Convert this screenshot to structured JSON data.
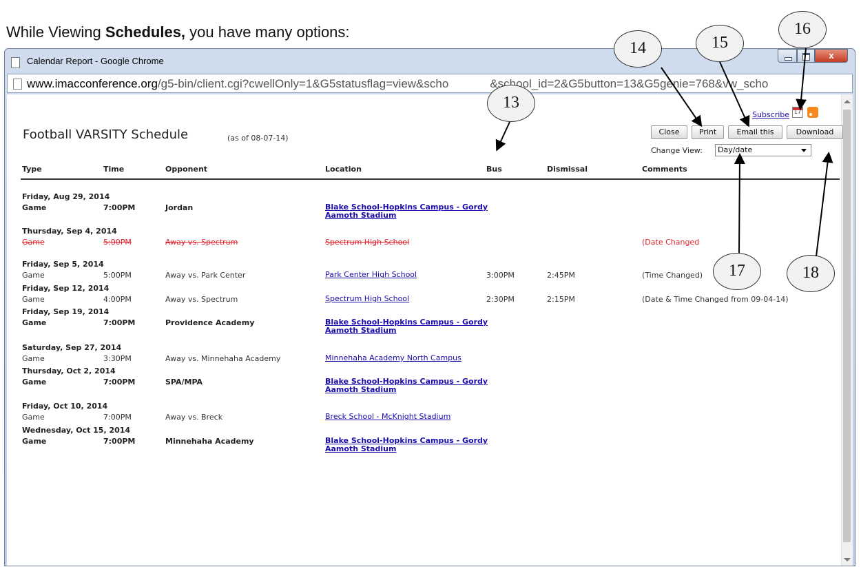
{
  "caption": {
    "prefix": "While Viewing ",
    "bold": "Schedules,",
    "suffix": " you have many options:"
  },
  "window": {
    "title": "Calendar Report - Google Chrome",
    "close_label": "x"
  },
  "address": {
    "domain": "www.imacconference.org",
    "path": "/g5-bin/client.cgi?cwellOnly=1&G5statusflag=view&scho",
    "path2": "&school_id=2&G5button=13&G5genie=768&vw_scho"
  },
  "header": {
    "title": "Football VARSITY Schedule",
    "as_of": "(as of 08-07-14)",
    "subscribe": "Subscribe",
    "buttons": {
      "close": "Close",
      "print": "Print",
      "email": "Email this",
      "download": "Download"
    },
    "change_view_label": "Change View:",
    "change_view_value": "Day/date"
  },
  "columns": [
    "Type",
    "Time",
    "Opponent",
    "Location",
    "Bus",
    "Dismissal",
    "Comments"
  ],
  "events": [
    {
      "date": "Friday, Aug 29, 2014",
      "type": "Game",
      "time": "7:00PM",
      "opponent": "Jordan",
      "location": "Blake School-Hopkins Campus - Gordy Aamoth Stadium",
      "bus": "",
      "dismissal": "",
      "comments": "",
      "home": true,
      "cancelled": false
    },
    {
      "date": "Thursday, Sep 4, 2014",
      "type": "Game",
      "time": "5:00PM",
      "opponent": "Away vs. Spectrum",
      "location": "Spectrum High School",
      "bus": "",
      "dismissal": "",
      "comments": "(Date Changed",
      "home": false,
      "cancelled": true
    },
    {
      "date": "Friday, Sep 5, 2014",
      "type": "Game",
      "time": "5:00PM",
      "opponent": "Away vs. Park Center",
      "location": "Park Center High School",
      "bus": "3:00PM",
      "dismissal": "2:45PM",
      "comments": "(Time Changed)",
      "home": false,
      "cancelled": false
    },
    {
      "date": "Friday, Sep 12, 2014",
      "type": "Game",
      "time": "4:00PM",
      "opponent": "Away vs. Spectrum",
      "location": "Spectrum High School",
      "bus": "2:30PM",
      "dismissal": "2:15PM",
      "comments": "(Date & Time Changed from 09-04-14)",
      "home": false,
      "cancelled": false
    },
    {
      "date": "Friday, Sep 19, 2014",
      "type": "Game",
      "time": "7:00PM",
      "opponent": "Providence Academy",
      "location": "Blake School-Hopkins Campus - Gordy Aamoth Stadium",
      "bus": "",
      "dismissal": "",
      "comments": "",
      "home": true,
      "cancelled": false
    },
    {
      "date": "Saturday, Sep 27, 2014",
      "type": "Game",
      "time": "3:30PM",
      "opponent": "Away vs. Minnehaha Academy",
      "location": "Minnehaha Academy North Campus",
      "bus": "",
      "dismissal": "",
      "comments": "",
      "home": false,
      "cancelled": false
    },
    {
      "date": "Thursday, Oct 2, 2014",
      "type": "Game",
      "time": "7:00PM",
      "opponent": "SPA/MPA",
      "location": "Blake School-Hopkins Campus - Gordy Aamoth Stadium",
      "bus": "",
      "dismissal": "",
      "comments": "",
      "home": true,
      "cancelled": false
    },
    {
      "date": "Friday, Oct 10, 2014",
      "type": "Game",
      "time": "7:00PM",
      "opponent": "Away vs. Breck",
      "location": "Breck School - McKnight Stadium",
      "bus": "",
      "dismissal": "",
      "comments": "",
      "home": false,
      "cancelled": false
    },
    {
      "date": "Wednesday, Oct 15, 2014",
      "type": "Game",
      "time": "7:00PM",
      "opponent": "Minnehaha Academy",
      "location": "Blake School-Hopkins Campus - Gordy Aamoth Stadium",
      "bus": "",
      "dismissal": "",
      "comments": "",
      "home": true,
      "cancelled": false
    }
  ],
  "callouts": [
    "13",
    "14",
    "15",
    "16",
    "17",
    "18"
  ]
}
